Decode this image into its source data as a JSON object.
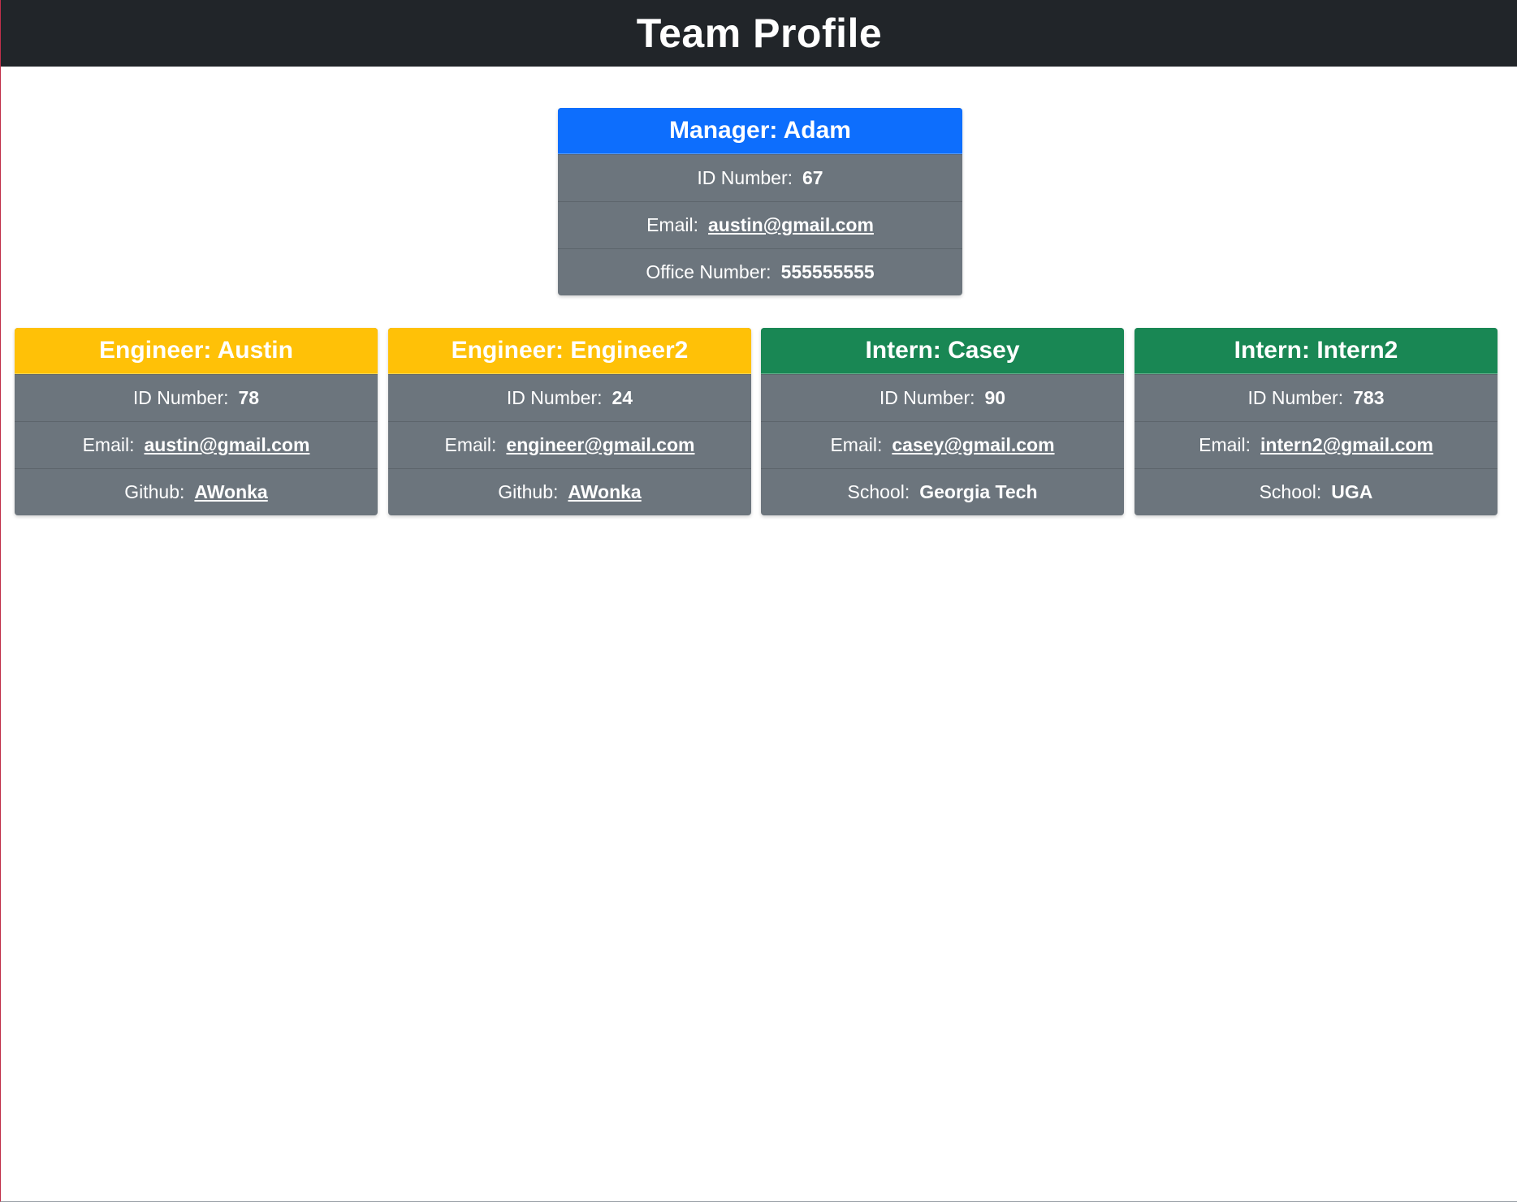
{
  "header": {
    "title": "Team Profile"
  },
  "colors": {
    "header_bg": "#212529",
    "manager": "#0d6efd",
    "engineer": "#ffc107",
    "intern": "#198754",
    "card_body": "#6c757d"
  },
  "manager": {
    "title": "Manager: Adam",
    "id_label": "ID Number:",
    "id": "67",
    "email_label": "Email:",
    "email": "austin@gmail.com",
    "office_label": "Office Number:",
    "office": "555555555"
  },
  "members": [
    {
      "title": "Engineer: Austin",
      "id_label": "ID Number:",
      "id": "78",
      "email_label": "Email:",
      "email": "austin@gmail.com",
      "extra_label": "Github:",
      "extra": "AWonka"
    },
    {
      "title": "Engineer: Engineer2",
      "id_label": "ID Number:",
      "id": "24",
      "email_label": "Email:",
      "email": "engineer@gmail.com",
      "extra_label": "Github:",
      "extra": "AWonka"
    },
    {
      "title": "Intern: Casey",
      "id_label": "ID Number:",
      "id": "90",
      "email_label": "Email:",
      "email": "casey@gmail.com",
      "extra_label": "School:",
      "extra": "Georgia Tech"
    },
    {
      "title": "Intern: Intern2",
      "id_label": "ID Number:",
      "id": "783",
      "email_label": "Email:",
      "email": "intern2@gmail.com",
      "extra_label": "School:",
      "extra": "UGA"
    }
  ]
}
